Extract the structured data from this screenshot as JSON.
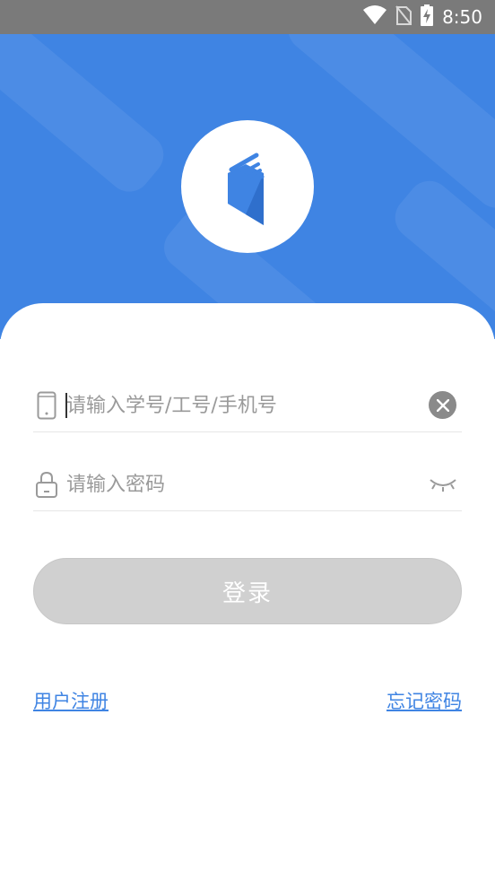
{
  "status_bar": {
    "time": "8:50",
    "icons": [
      "wifi-icon",
      "no-sim-icon",
      "battery-charging-icon"
    ]
  },
  "login_form": {
    "account": {
      "placeholder": "请输入学号/工号/手机号",
      "value": "",
      "icon": "phone-icon",
      "clear_icon": "clear-icon"
    },
    "password": {
      "placeholder": "请输入密码",
      "value": "",
      "icon": "lock-icon",
      "visibility_icon": "eye-closed-icon"
    },
    "login_button_label": "登录"
  },
  "links": {
    "register": "用户注册",
    "forgot_password": "忘记密码"
  },
  "colors": {
    "primary": "#3f84e3",
    "status_bar": "#7a7a7a",
    "button_disabled": "#d0d0d0"
  }
}
